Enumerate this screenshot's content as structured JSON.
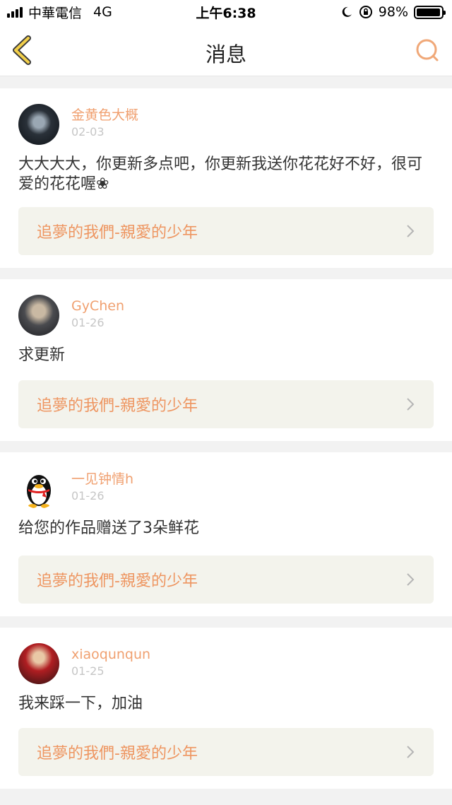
{
  "status_bar": {
    "carrier": "中華電信",
    "network": "4G",
    "time": "上午6:38",
    "battery": "98%",
    "battery_level": 0.98
  },
  "nav": {
    "title": "消息",
    "back_icon": "chevron-left-icon",
    "search_icon": "search-icon",
    "accent_color": "#f0c23a"
  },
  "messages": [
    {
      "user": "金黄色大概",
      "date": "02-03",
      "text": "大大大大，你更新多点吧，你更新我送你花花好不好，很可爱的花花喔❀",
      "work": "追夢的我們-親愛的少年"
    },
    {
      "user": "GyChen",
      "date": "01-26",
      "text": "求更新",
      "work": "追夢的我們-親愛的少年"
    },
    {
      "user": "一见钟情h",
      "date": "01-26",
      "text": "给您的作品赠送了3朵鲜花",
      "work": "追夢的我們-親愛的少年"
    },
    {
      "user": "xiaoqunqun",
      "date": "01-25",
      "text": "我来踩一下，加油",
      "work": "追夢的我們-親愛的少年"
    }
  ],
  "colors": {
    "username": "#f0a070",
    "work_title": "#ee9560",
    "link_background": "#f3f3ec"
  }
}
